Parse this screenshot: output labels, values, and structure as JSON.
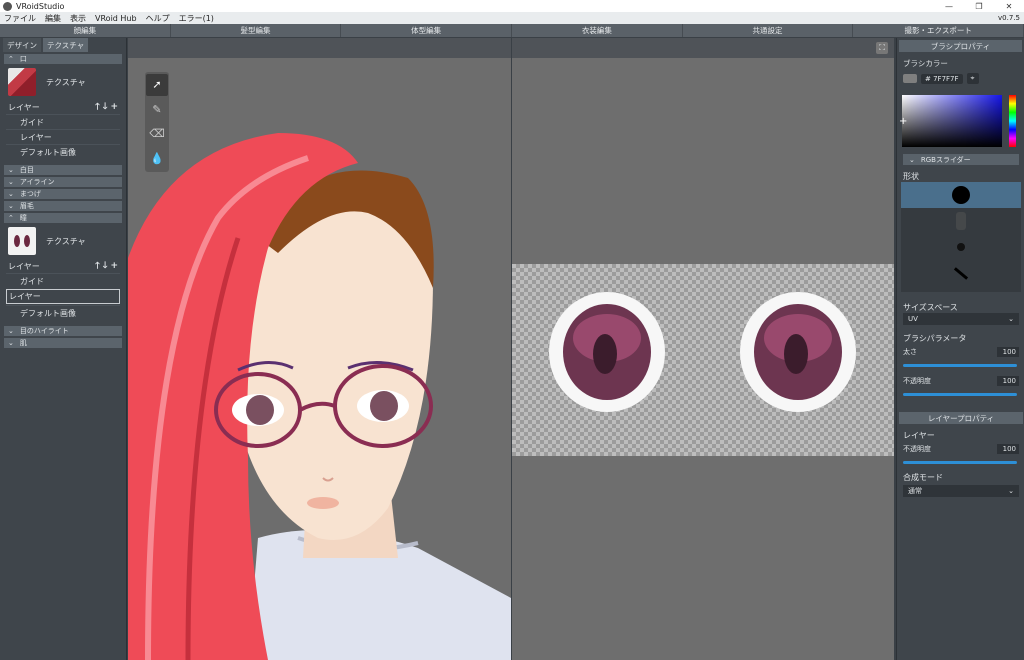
{
  "window": {
    "title": "VRoidStudio",
    "version": "v0.7.5"
  },
  "menu": [
    "ファイル",
    "編集",
    "表示",
    "VRoid Hub",
    "ヘルプ",
    "エラー(1)"
  ],
  "mode_tabs": [
    "顔編集",
    "髪型編集",
    "体型編集",
    "衣装編集",
    "共通設定",
    "撮影・エクスポート"
  ],
  "left": {
    "tabs": [
      "デザイン",
      "テクスチャ"
    ],
    "sections": {
      "mouth": "口",
      "white_eye": "白目",
      "eyeline": "アイライン",
      "eyelash": "まつげ",
      "eyebrow": "眉毛",
      "iris": "瞳",
      "eye_highlight": "目のハイライト",
      "skin": "肌"
    },
    "texture_label": "テクスチャ",
    "layer_label": "レイヤー",
    "layer_actions": [
      "🡑",
      "🡓",
      "+"
    ],
    "items_top": [
      "ガイド",
      "レイヤー",
      "デフォルト画像"
    ],
    "items_bottom": [
      "ガイド",
      "レイヤー",
      "デフォルト画像"
    ]
  },
  "right": {
    "brush_props": "ブラシプロパティ",
    "brush_color": "ブラシカラー",
    "hex": "# 7F7F7F",
    "rgb_slider": "RGBスライダー",
    "shape": "形状",
    "size_space": "サイズスペース",
    "size_space_value": "UV",
    "brush_params": "ブラシパラメータ",
    "thickness": "太さ",
    "thickness_value": "100",
    "opacity": "不透明度",
    "opacity_value": "100",
    "layer_props": "レイヤープロパティ",
    "layer": "レイヤー",
    "layer_opacity": "不透明度",
    "layer_opacity_value": "100",
    "blend_mode": "合成モード",
    "blend_mode_value": "通常"
  },
  "colors": {
    "brush": "#7F7F7F",
    "accent": "#2d8fd6",
    "selection": "#4a6f8c"
  }
}
